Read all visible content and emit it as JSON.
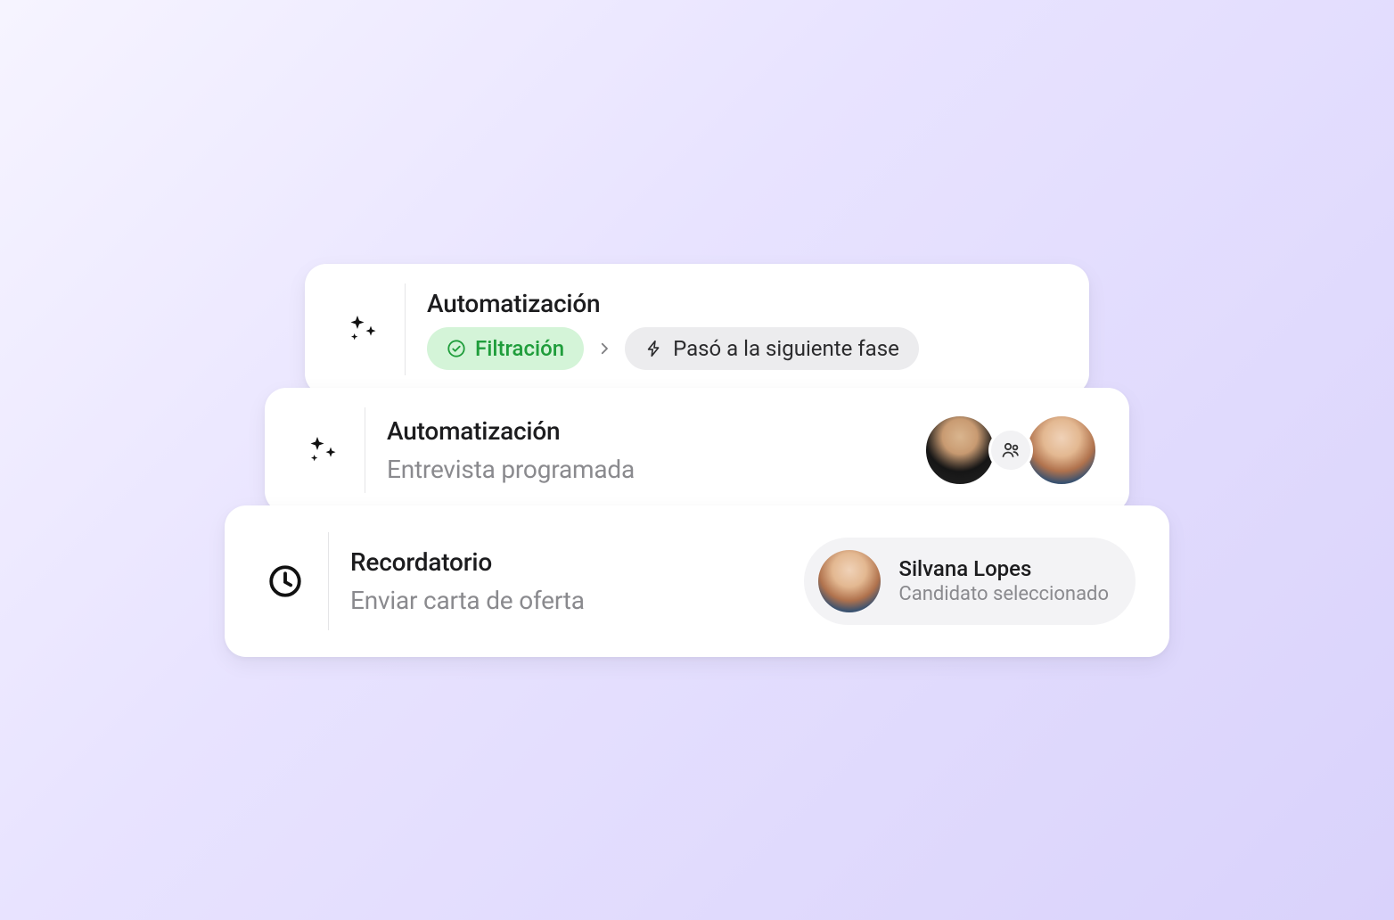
{
  "cards": [
    {
      "icon": "sparkle",
      "title": "Automatización",
      "pills": {
        "green": "Filtración",
        "gray": "Pasó a la siguiente fase"
      }
    },
    {
      "icon": "sparkle",
      "title": "Automatización",
      "subtitle": "Entrevista programada"
    },
    {
      "icon": "clock",
      "title": "Recordatorio",
      "subtitle": "Enviar carta de oferta",
      "candidate": {
        "name": "Silvana Lopes",
        "role": "Candidato seleccionado"
      }
    }
  ]
}
